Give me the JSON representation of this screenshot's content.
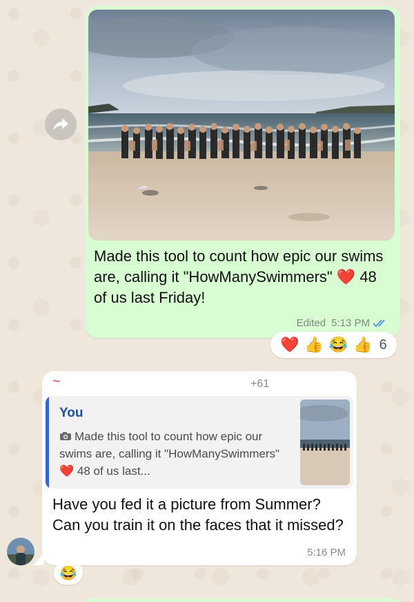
{
  "colors": {
    "wallpaper": "#efe7dc",
    "outgoing_bubble": "#d9fdd3",
    "incoming_bubble": "#ffffff",
    "quote_bar": "#3366cc",
    "quote_author": "#1f4f9e",
    "read_ticks": "#4a90e2",
    "sender_tilde": "#d2425b"
  },
  "forward": {
    "icon": "forward-arrow-icon"
  },
  "outgoing": {
    "image": "beach-group-photo",
    "text": "Made this tool to count how epic our swims are, calling it \"HowManySwimmers\" ❤️ 48 of us last Friday!",
    "edited_label": "Edited",
    "time": "5:13 PM",
    "status_icon": "double-check-read-icon",
    "reactions": [
      "❤️",
      "👍",
      "😂",
      "👍"
    ],
    "reaction_count": "6"
  },
  "incoming": {
    "sender_name": "~",
    "sender_count": "+61",
    "quote": {
      "author": "You",
      "icon": "camera-icon",
      "text": "Made this tool to count how epic our swims are, calling it \"HowManySwimmers\" ❤️ 48 of us last...",
      "thumb": "beach-group-photo-thumb"
    },
    "text": "Have you fed it a picture from Summer? Can you train it on the faces that it missed?",
    "time": "5:16 PM",
    "reaction": "😂"
  },
  "avatar": {
    "icon": "user-avatar"
  }
}
